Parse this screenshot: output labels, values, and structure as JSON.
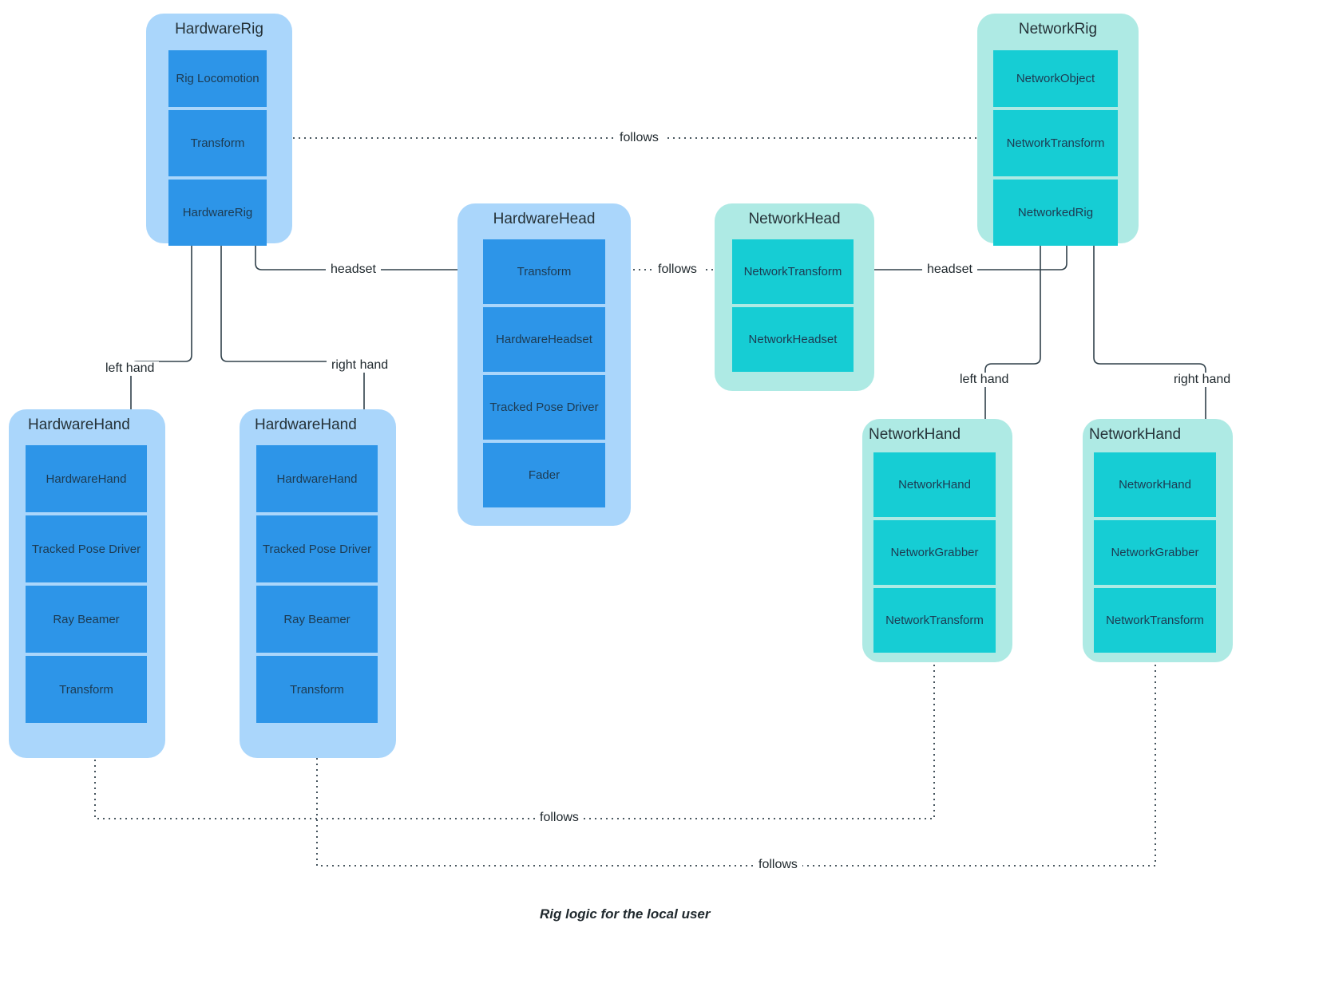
{
  "caption": "Rig logic for the local user",
  "colors": {
    "hardware_group_bg": "#aad6fb",
    "hardware_item_bg": "#2d95e8",
    "network_group_bg": "#aeeae4",
    "network_item_bg": "#16cdd4",
    "text": "#1d3b52",
    "line": "#30404a",
    "background": "#ffffff"
  },
  "groups": {
    "hardware_rig": {
      "title": "HardwareRig",
      "items": [
        "Rig Locomotion",
        "Transform",
        "HardwareRig"
      ]
    },
    "hardware_head": {
      "title": "HardwareHead",
      "items": [
        "Transform",
        "HardwareHeadset",
        "Tracked Pose Driver",
        "Fader"
      ]
    },
    "hardware_hand_left": {
      "title": "HardwareHand",
      "items": [
        "HardwareHand",
        "Tracked Pose Driver",
        "Ray Beamer",
        "Transform"
      ]
    },
    "hardware_hand_right": {
      "title": "HardwareHand",
      "items": [
        "HardwareHand",
        "Tracked Pose Driver",
        "Ray Beamer",
        "Transform"
      ]
    },
    "network_rig": {
      "title": "NetworkRig",
      "items": [
        "NetworkObject",
        "NetworkTransform",
        "NetworkedRig"
      ]
    },
    "network_head": {
      "title": "NetworkHead",
      "items": [
        "NetworkTransform",
        "NetworkHeadset"
      ]
    },
    "network_hand_left": {
      "title": "NetworkHand",
      "items": [
        "NetworkHand",
        "NetworkGrabber",
        "NetworkTransform"
      ]
    },
    "network_hand_right": {
      "title": "NetworkHand",
      "items": [
        "NetworkHand",
        "NetworkGrabber",
        "NetworkTransform"
      ]
    }
  },
  "edges": {
    "follows_rig": "follows",
    "headset_hw": "headset",
    "follows_head": "follows",
    "headset_net": "headset",
    "left_hand_hw": "left hand",
    "right_hand_hw": "right hand",
    "left_hand_net": "left hand",
    "right_hand_net": "right hand",
    "follows_left_hand": "follows",
    "follows_right_hand": "follows"
  }
}
